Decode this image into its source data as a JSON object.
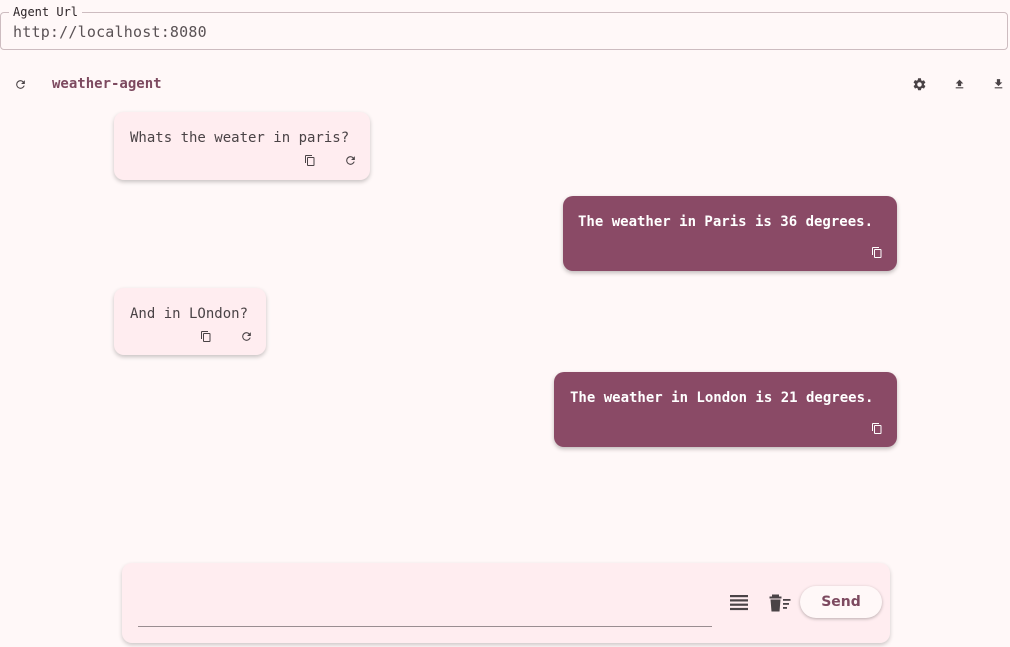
{
  "agent_url": {
    "label": "Agent Url",
    "value": "http://localhost:8080"
  },
  "header": {
    "agent_name": "weather-agent",
    "refresh_icon": "refresh-icon",
    "settings_icon": "gear-icon",
    "upload_icon": "upload-icon",
    "download_icon": "download-icon"
  },
  "messages": [
    {
      "role": "user",
      "text": "Whats the weater in paris?"
    },
    {
      "role": "agent",
      "text": "The weather in Paris is 36 degrees."
    },
    {
      "role": "user",
      "text": "And in LOndon?"
    },
    {
      "role": "agent",
      "text": "The weather in London is 21 degrees."
    }
  ],
  "composer": {
    "input_value": "",
    "send_label": "Send",
    "list_icon": "list-icon",
    "clear_icon": "delete-sweep-icon"
  },
  "colors": {
    "background": "#fff8f8",
    "agent_bubble": "#8a4a66",
    "user_bubble": "#ffedf0",
    "accent_text": "#7d4a60"
  }
}
